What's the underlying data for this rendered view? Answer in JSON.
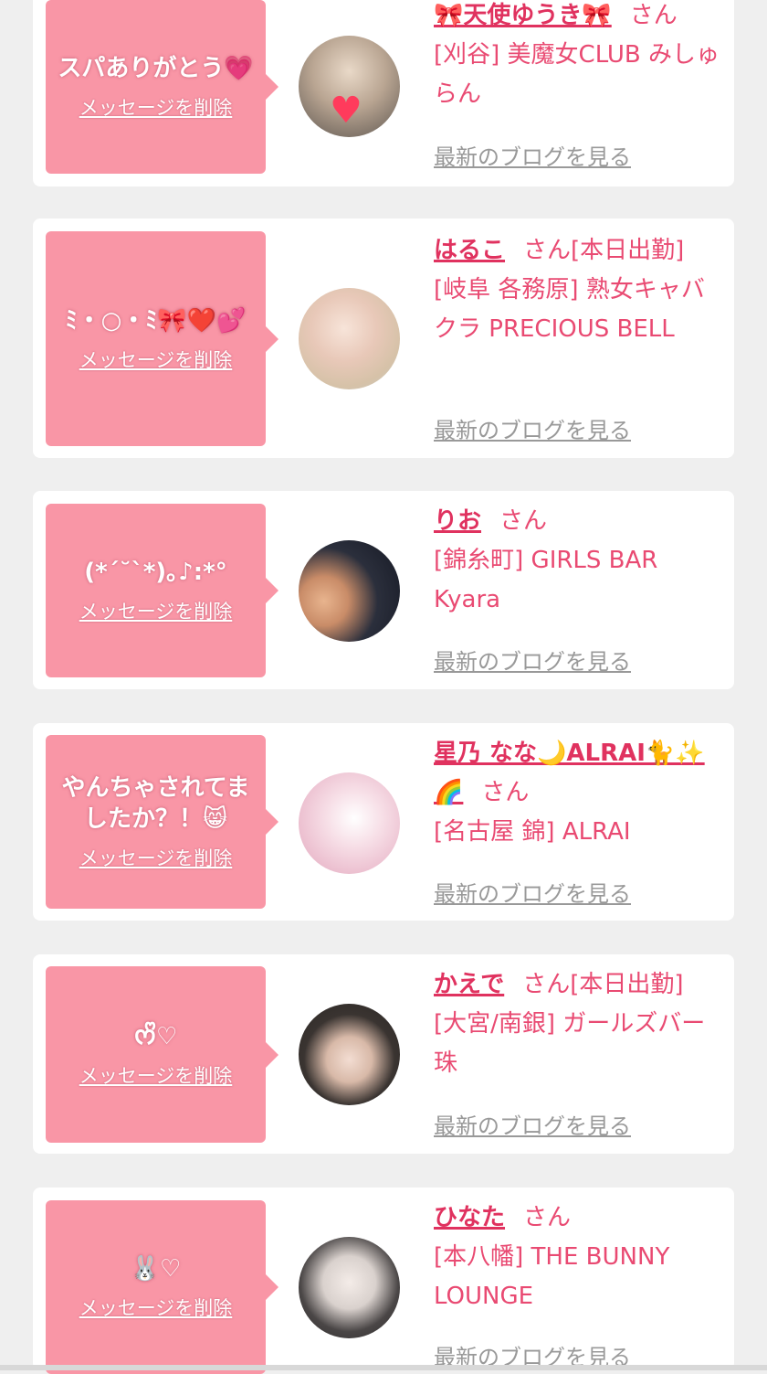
{
  "delete_label": "メッセージを削除",
  "blog_label": "最新のブログを見る",
  "san_label": "さん",
  "items": [
    {
      "message": "スパありがとう💗",
      "name": "🎀天使ゆうき🎀",
      "after_name": "",
      "shop": "[刈谷] 美魔女CLUB みしゅらん"
    },
    {
      "message": "ﾐ・○・ﾐ🎀❤️💕",
      "name": "はるこ",
      "after_name": "[本日出勤]",
      "shop": "[岐阜 各務原]  熟女キャバクラ PRECIOUS BELL"
    },
    {
      "message": "(*´˘`*)｡♪:*°",
      "name": "りお",
      "after_name": "",
      "shop": "[錦糸町] GIRLS BAR Kyara"
    },
    {
      "message": "やんちゃされてましたか？！😸",
      "name": "星乃 なな🌙ALRAI🐈✨🌈",
      "after_name": "",
      "shop": "[名古屋 錦] ALRAI"
    },
    {
      "message": "ᰔᩚ♡",
      "name": "かえで",
      "after_name": "[本日出勤]",
      "shop": "[大宮/南銀] ガールズバー 珠"
    },
    {
      "message": "🐰♡",
      "name": "ひなた",
      "after_name": "",
      "shop": "[本八幡] THE BUNNY LOUNGE"
    }
  ]
}
